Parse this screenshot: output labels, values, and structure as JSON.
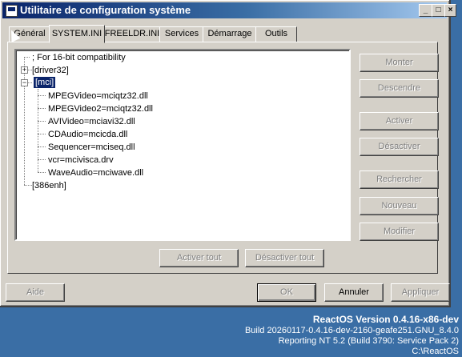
{
  "window": {
    "title": "Utilitaire de configuration système",
    "caption_buttons": {
      "minimize": "_",
      "maximize": "□",
      "close": "×"
    }
  },
  "tabs": [
    {
      "label": "Général",
      "active": false
    },
    {
      "label": "SYSTEM.INI",
      "active": true
    },
    {
      "label": "FREELDR.INI",
      "active": false
    },
    {
      "label": "Services",
      "active": false
    },
    {
      "label": "Démarrage",
      "active": false
    },
    {
      "label": "Outils",
      "active": false
    }
  ],
  "tree": {
    "comment": "; For 16-bit compatibility",
    "driver32": "[driver32]",
    "mci": "[mci]",
    "mci_children": [
      "MPEGVideo=mciqtz32.dll",
      "MPEGVideo2=mciqtz32.dll",
      "AVIVideo=mciavi32.dll",
      "CDAudio=mcicda.dll",
      "Sequencer=mciseq.dll",
      "vcr=mcivisca.drv",
      "WaveAudio=mciwave.dll"
    ],
    "enh386": "[386enh]",
    "expander_plus": "+",
    "expander_minus": "−"
  },
  "side_buttons": {
    "up": "Monter",
    "down": "Descendre",
    "enable": "Activer",
    "disable": "Désactiver",
    "search": "Rechercher",
    "new": "Nouveau",
    "edit": "Modifier"
  },
  "bulk_buttons": {
    "enable_all": "Activer tout",
    "disable_all": "Désactiver tout"
  },
  "footer_buttons": {
    "help": "Aide",
    "ok": "OK",
    "cancel": "Annuler",
    "apply": "Appliquer"
  },
  "desktop": {
    "version": "ReactOS Version 0.4.16-x86-dev",
    "build": "Build 20260117-0.4.16-dev-2160-geafe251.GNU_8.4.0",
    "reporting": "Reporting NT 5.2 (Build 3790: Service Pack 2)",
    "path": "C:\\ReactOS"
  }
}
